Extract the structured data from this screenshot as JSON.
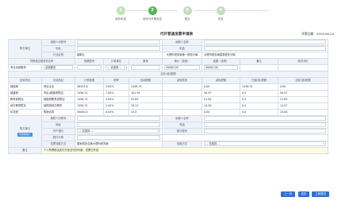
{
  "steps": [
    {
      "num": "1",
      "label": "我的申请"
    },
    {
      "num": "2",
      "label": "填写代开票信息"
    },
    {
      "num": "3",
      "label": "提交"
    },
    {
      "num": "4",
      "label": "完成"
    }
  ],
  "form": {
    "title": "代开普通发票申请表",
    "date_label": "开票日期：2019-06-20"
  },
  "seller": {
    "section_label": "购方单位",
    "name_label": "纳税人识别号",
    "name_value": "",
    "name_label2": "纳税人名称",
    "addr_label": "地址",
    "addr_label2": "电话",
    "bank_label": "行业区别",
    "bank_value": "建筑业",
    "industry_label2": "所属税务机关",
    "industry_value2": "大理市税务局第一税务分局",
    "tax_org_value": "大理市税务局直属税务分局"
  },
  "goods_header": [
    "货物或应税劳务名称",
    "规格型号",
    "计量单位",
    "数量",
    "单价（含税）",
    "金额（含税）",
    "备注",
    "退货冲红"
  ],
  "goods_row": {
    "name": "专业全保服务",
    "spec": "全保服务",
    "unit": "— 请选择 —",
    "qty": "",
    "price": "50000.00",
    "amount": "50000.00"
  },
  "tax_section_label": "应补(退)税额",
  "tax_header": [
    "征收项目",
    "征收品目",
    "计税依据",
    "税率",
    "应纳税额",
    "减免性质",
    "减免税额",
    "已缴(扣)税额",
    "应补(退)税额"
  ],
  "tax_rows": [
    {
      "item": "增值税",
      "sub": "商业企业",
      "base": "48543.6",
      "rate": "3.00%",
      "tax": "1456.31",
      "relief": "",
      "relief_amt": "0.00",
      "paid": "1456.31",
      "due": "0.00"
    },
    {
      "item": "城建税",
      "sub": "市区(增值税附征)",
      "base": "1456.31",
      "rate": "7.00%",
      "tax": "101.94",
      "relief": "",
      "relief_amt": "50.97",
      "paid": "0.5",
      "due": "50.97"
    },
    {
      "item": "教育费附加",
      "sub": "增值税教育费附加",
      "base": "1456.31",
      "rate": "3.00%",
      "tax": "43.69",
      "relief": "",
      "relief_amt": "21.84",
      "paid": "0.5",
      "due": "21.85"
    },
    {
      "item": "地方教育附加",
      "sub": "增值税地方教育",
      "base": "1456.31",
      "rate": "2.00%",
      "tax": "29.13",
      "relief": "",
      "relief_amt": "14.56",
      "paid": "0.5",
      "due": "14.57"
    },
    {
      "item": "印花税",
      "sub": "购销合同",
      "base": "50000.0",
      "rate": "0.03%",
      "tax": "15.0",
      "relief": "",
      "relief_amt": "0.00",
      "paid": "0.0",
      "due": "15.00"
    }
  ],
  "buyer": {
    "section_label": "购方单位",
    "change_button": "切换纳税人",
    "id_label": "纳税人识别号",
    "name_label": "纳税人名称",
    "addr_label": "地址",
    "phone_label": "电话",
    "bank_label": "开户银行",
    "bank_placeholder": "— 请选择 —",
    "account_label": "银行账号",
    "sms_label": "银行行别"
  },
  "pickup": {
    "label": "发票领取方式",
    "value": "国家税务总局大理市税务局",
    "label2": "领取方式",
    "placeholder": "— 请选择 —"
  },
  "note": {
    "label": "备注",
    "value": "个人所得税由支付方依法代扣代缴，发票已开具"
  },
  "buttons": {
    "prev": "上一步",
    "save": "保存",
    "submit": "立即提交"
  }
}
